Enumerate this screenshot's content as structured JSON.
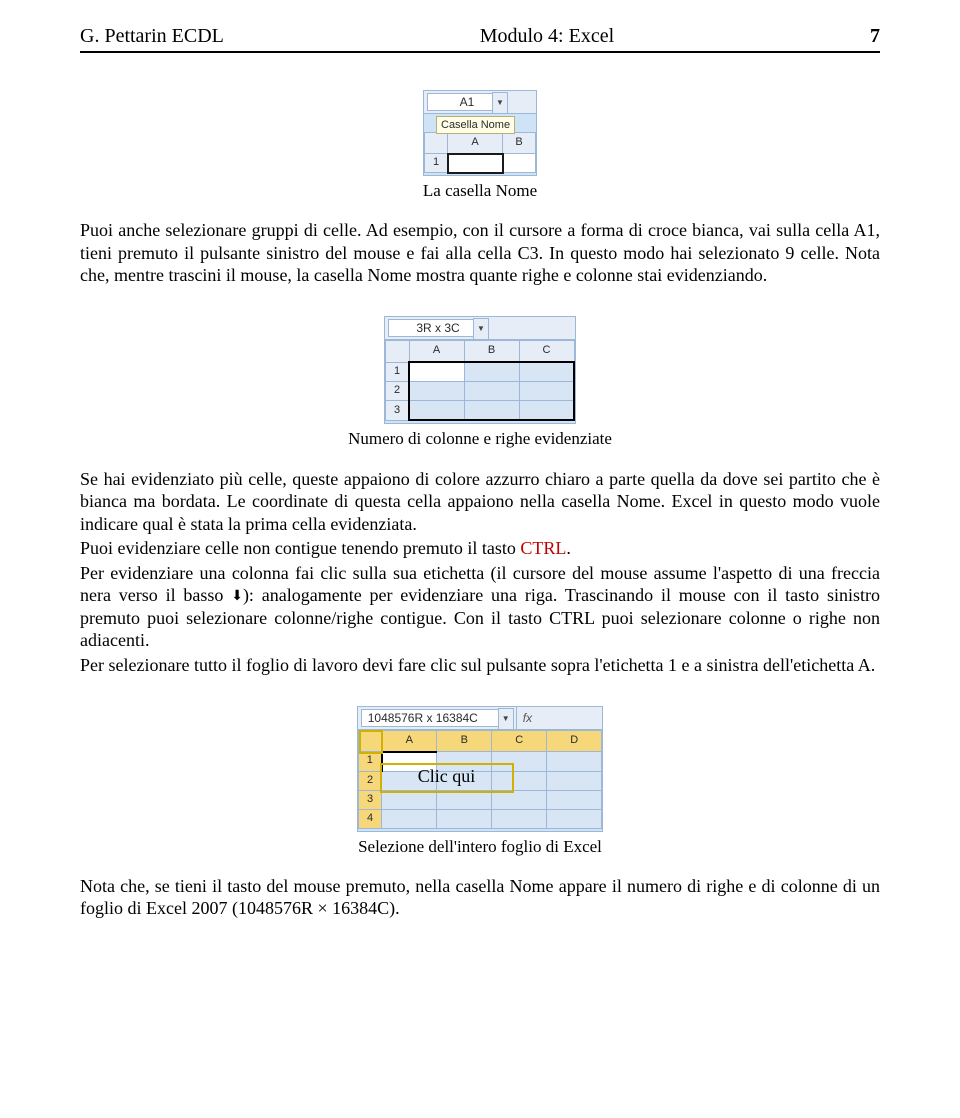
{
  "header": {
    "left": "G. Pettarin ECDL",
    "center": "Modulo 4: Excel",
    "right": "7"
  },
  "fig1": {
    "namebox": "A1",
    "tooltip": "Casella Nome",
    "cols": [
      "A",
      "B"
    ],
    "rows": [
      "1"
    ],
    "caption": "La casella Nome"
  },
  "para1": "Puoi anche selezionare gruppi di celle. Ad esempio, con il cursore a forma di croce bianca, vai sulla cella A1, tieni premuto il pulsante sinistro del mouse e fai alla cella C3. In questo modo hai selezionato 9 celle. Nota che, mentre trascini il mouse, la casella Nome mostra quante righe e colonne stai evidenziando.",
  "fig2": {
    "namebox": "3R x 3C",
    "cols": [
      "A",
      "B",
      "C"
    ],
    "rows": [
      "1",
      "2",
      "3"
    ],
    "caption": "Numero di colonne e righe evidenziate"
  },
  "para2a": "Se hai evidenziato più celle, queste appaiono di colore azzurro chiaro a parte quella da dove sei partito che è bianca ma bordata. Le coordinate di questa cella appaiono nella casella Nome. Excel in questo modo vuole indicare qual è stata la prima cella evidenziata.",
  "para2b_prefix": "Puoi evidenziare celle non contigue tenendo premuto il tasto ",
  "para2b_ctrl": "CTRL",
  "para2b_suffix": ".",
  "para2c_prefix": "Per evidenziare una colonna fai clic sulla sua etichetta (il cursore del mouse assume l'aspetto di una freccia nera verso il basso ",
  "para2c_suffix": "): analogamente per evidenziare una riga. Trascinando il mouse con il tasto sinistro premuto puoi selezionare colonne/righe contigue. Con il tasto CTRL puoi selezionare colonne o righe non adiacenti.",
  "para2d": "Per selezionare tutto il foglio di lavoro devi fare clic sul pulsante sopra l'etichetta 1 e a sinistra dell'etichetta A.",
  "fig3": {
    "namebox": "1048576R x 16384C",
    "fx": "fx",
    "cols": [
      "A",
      "B",
      "C",
      "D"
    ],
    "rows": [
      "1",
      "2",
      "3",
      "4"
    ],
    "overlay": "Clic qui",
    "caption": "Selezione dell'intero foglio di Excel"
  },
  "para3": "Nota che, se tieni il tasto del mouse premuto, nella casella Nome appare il numero di righe e di colonne di un foglio di Excel 2007 (1048576R × 16384C)."
}
